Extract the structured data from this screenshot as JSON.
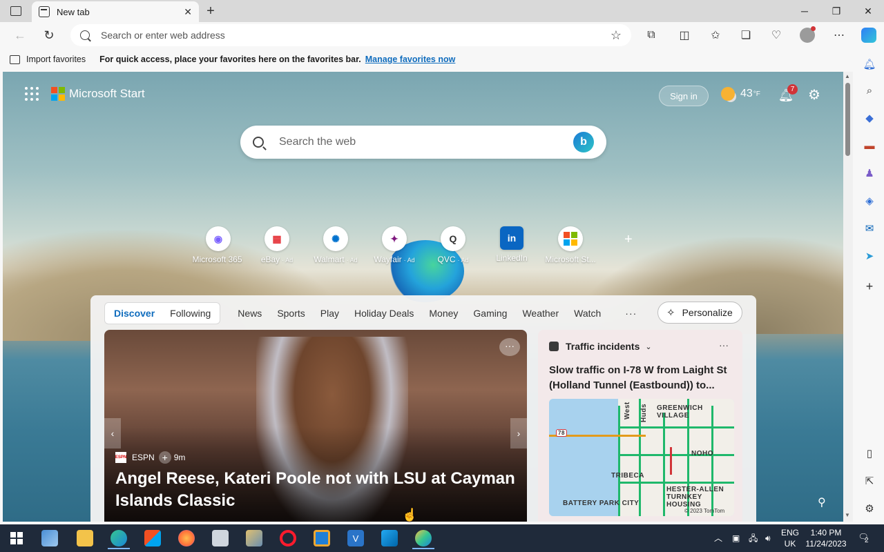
{
  "window": {
    "tab_title": "New tab",
    "new_tab_symbol": "+",
    "controls": {
      "minimize": "─",
      "restore": "❐",
      "close": "✕"
    }
  },
  "toolbar": {
    "address_placeholder": "Search or enter web address"
  },
  "favorites_bar": {
    "import_label": "Import favorites",
    "message": "For quick access, place your favorites here on the favorites bar.",
    "manage_link": "Manage favorites now"
  },
  "header": {
    "brand": "Microsoft Start",
    "sign_in": "Sign in",
    "temperature": "43",
    "temperature_unit": "°F",
    "notification_count": "7"
  },
  "search": {
    "placeholder": "Search the web"
  },
  "quick_links": [
    {
      "label": "Microsoft 365",
      "ad": "",
      "glyph": "◉",
      "color": "#7b61ff"
    },
    {
      "label": "eBay",
      "ad": "· Ad",
      "glyph": "▦",
      "color": "#e53238"
    },
    {
      "label": "Walmart",
      "ad": "· Ad",
      "glyph": "✺",
      "color": "#0071ce"
    },
    {
      "label": "Wayfair",
      "ad": "· Ad",
      "glyph": "✦",
      "color": "#7f187f"
    },
    {
      "label": "QVC",
      "ad": "· Ad",
      "glyph": "Q",
      "color": "#333333"
    },
    {
      "label": "LinkedIn",
      "ad": "",
      "glyph": "in",
      "color": "#0a66c2"
    },
    {
      "label": "Microsoft St...",
      "ad": "",
      "glyph": "▣",
      "color": "#f25022"
    }
  ],
  "feed": {
    "segment_tabs": [
      "Discover",
      "Following"
    ],
    "active_tab": "Discover",
    "categories": [
      "News",
      "Sports",
      "Play",
      "Holiday Deals",
      "Money",
      "Gaming",
      "Weather",
      "Watch"
    ],
    "more": "···",
    "personalize": "Personalize",
    "hero": {
      "source": "ESPN",
      "source_logo": "ESPN",
      "age": "9m",
      "headline": "Angel Reese, Kateri Poole not with LSU at Cayman Islands Classic"
    },
    "traffic": {
      "heading": "Traffic incidents",
      "title": "Slow traffic on I-78 W from Laight St (Holland Tunnel (Eastbound)) to...",
      "map_labels": [
        "GREENWICH VILLAGE",
        "NOHO",
        "TRIBECA",
        "HESTER-ALLEN TURNKEY HOUSING",
        "BATTERY PARK CITY",
        "West",
        "Huds",
        "78"
      ],
      "copyright": "© 2023 TomTom"
    }
  },
  "taskbar": {
    "language": "ENG",
    "region": "UK",
    "time": "1:40 PM",
    "date": "11/24/2023",
    "notifications": "2"
  },
  "colors": {
    "accent": "#0f6cbd",
    "ms_red": "#f25022",
    "ms_green": "#7fba00",
    "ms_blue": "#00a4ef",
    "ms_yellow": "#ffb900"
  }
}
